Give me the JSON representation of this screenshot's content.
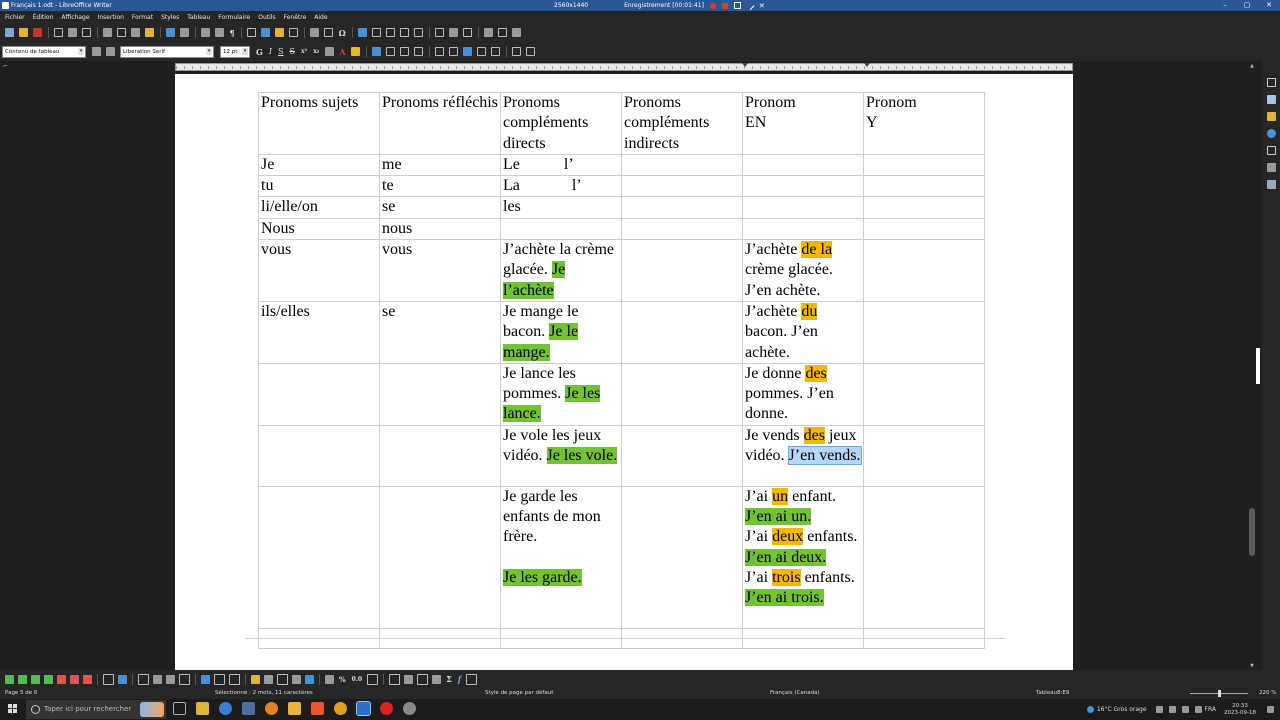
{
  "window": {
    "title": "Français 1.odt - LibreOffice Writer",
    "recording_resolution": "2560x1440",
    "recording_title": "Enregistrement [00:01:41]"
  },
  "menu": [
    "Fichier",
    "Édition",
    "Affichage",
    "Insertion",
    "Format",
    "Styles",
    "Tableau",
    "Formulaire",
    "Outils",
    "Fenêtre",
    "Aide"
  ],
  "format_bar": {
    "paragraph_style": "Contenu de tableau",
    "font_name": "Liberation Serif",
    "font_size": "12 pt"
  },
  "table": {
    "headers": [
      "Pronoms sujets",
      "Pronoms réfléchis",
      "Pronoms compléments directs",
      "Pronoms compléments indirects",
      "Pronom EN",
      "Pronom  Y"
    ],
    "rows": [
      {
        "sujet": "Je",
        "reflechi": "me",
        "direct_a": "Le",
        "direct_b": "l’"
      },
      {
        "sujet": "tu",
        "reflechi": "te",
        "direct_a": "La",
        "direct_b": "l’"
      },
      {
        "sujet": "li/elle/on",
        "reflechi": "se",
        "direct_a": "les"
      },
      {
        "sujet": "Nous",
        "reflechi": "nous"
      },
      {
        "sujet": "vous",
        "reflechi": "vous"
      },
      {
        "sujet": "ils/elles",
        "reflechi": "se"
      }
    ],
    "direct_examples": [
      {
        "plain": "J’achète la crème glacée.",
        "highlight": "Je l’achète"
      },
      {
        "plain": "Je mange le bacon.",
        "highlight": "Je le mange."
      },
      {
        "plain": "Je lance les pommes.",
        "highlight": "Je les lance."
      },
      {
        "plain": "Je vole les jeux vidéo.",
        "highlight": "Je les vole."
      },
      {
        "plain": "Je garde les enfants de mon frère.",
        "highlight": "Je les garde."
      }
    ],
    "en_examples": [
      {
        "pre": "J’achète ",
        "hl": "de la",
        "post": " crème glacée. J’en achète."
      },
      {
        "pre": "J’achète ",
        "hl": "du",
        "post": " bacon. J’en achète."
      },
      {
        "pre": "Je donne ",
        "hl": "des",
        "post": " pommes. J’en donne."
      },
      {
        "pre": "Je vends ",
        "hl": "des",
        "post": " jeux vidéo. ",
        "selected": "J’en vends."
      }
    ],
    "en_last": {
      "l1_pre": "J’ai ",
      "l1_hl": "un",
      "l1_post": " enfant.",
      "l2": "J’en ai un.",
      "l3_pre": "J’ai ",
      "l3_hl": "deux",
      "l3_post": " enfants.",
      "l4": "J’en ai deux.",
      "l5_pre": "J’ai ",
      "l5_hl": "trois",
      "l5_post": " enfants.",
      "l6": "J’en ai trois."
    }
  },
  "colors": {
    "highlight_green": "#72c236",
    "highlight_orange": "#f5b800",
    "selection": "#b4d7f7"
  },
  "statusbar": {
    "page": "Page 5 de 6",
    "selection": "Sélectionné : 2 mots, 11 caractères",
    "page_style": "Style de page par défaut",
    "language": "Français (Canada)",
    "cell": "Tableau8:E9",
    "zoom": "220 %"
  },
  "taskbar": {
    "search_placeholder": "Taper ici pour rechercher",
    "weather": "16°C  Gros orage",
    "lang": "FRA",
    "time": "20:33",
    "date": "2023-09-18"
  }
}
